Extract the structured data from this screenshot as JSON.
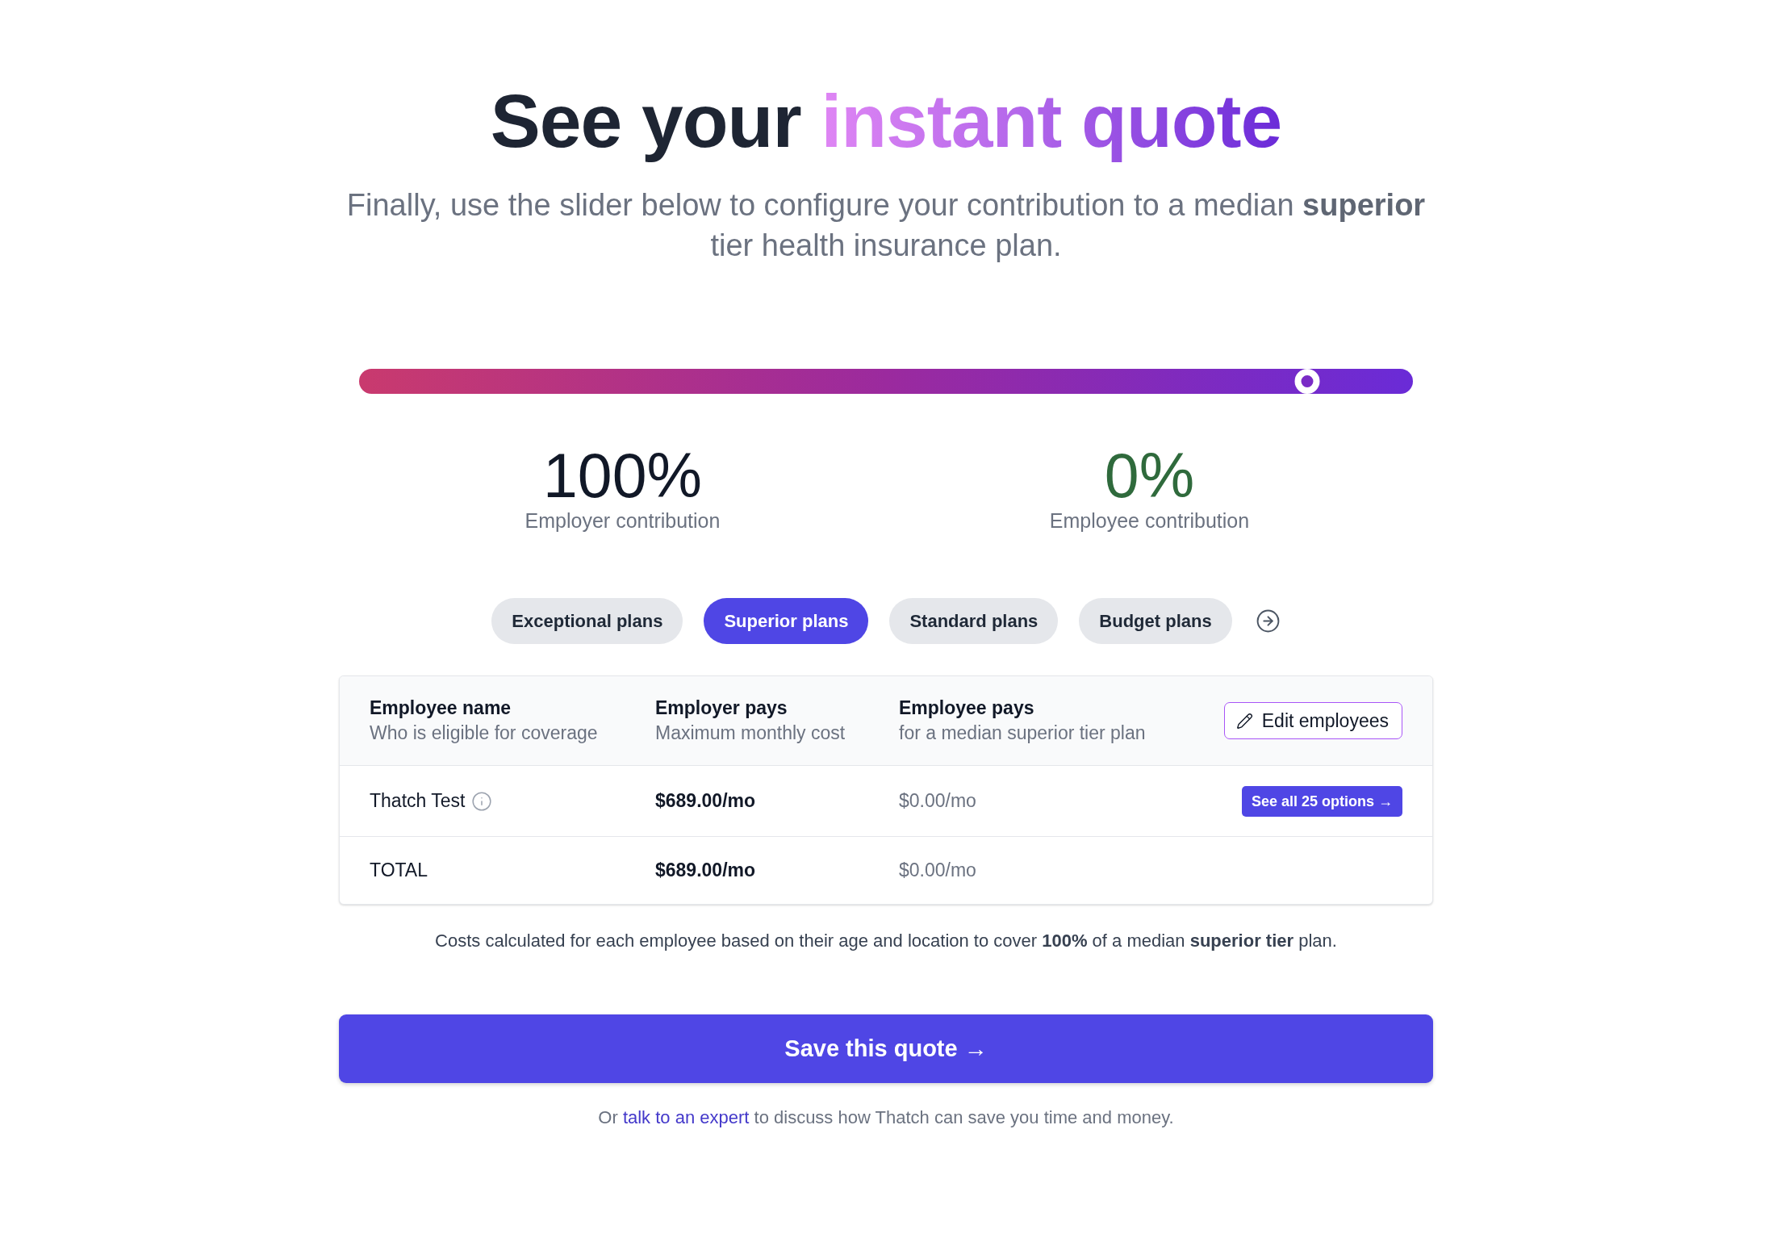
{
  "title": {
    "text": "See your",
    "highlight": "instant quote"
  },
  "subtitle": "Finally, use the slider below to configure your contribution to a median **superior** tier health insurance plan.",
  "slider": {
    "level": 0.9
  },
  "contributions": [
    {
      "value": "100%",
      "label": "Employer contribution",
      "color": "#111827"
    },
    {
      "value": "0%",
      "label": "Employee contribution",
      "color": "#2f6a3c"
    }
  ],
  "plan_tabs": [
    {
      "label": "Exceptional plans",
      "selected": false
    },
    {
      "label": "Superior plans",
      "selected": true
    },
    {
      "label": "Standard plans",
      "selected": false
    },
    {
      "label": "Budget plans",
      "selected": false
    }
  ],
  "table": {
    "columns": [
      {
        "title": "Employee name",
        "subtitle": "Who is eligible for coverage"
      },
      {
        "title": "Employer pays",
        "subtitle": "Maximum monthly cost"
      },
      {
        "title": "Employee pays",
        "subtitle": "for a median superior tier plan"
      }
    ],
    "edit_button": "Edit employees",
    "rows": [
      {
        "kind": "employee",
        "name": "Thatch Test",
        "employer_pays": "$689.00/mo",
        "employee_pays": "$0.00/mo",
        "action": "See all 25 options →"
      },
      {
        "kind": "total",
        "name": "TOTAL",
        "employer_pays": "$689.00/mo",
        "employee_pays": "$0.00/mo"
      }
    ]
  },
  "cost_note": "Costs calculated for each employee based on their age and location to cover **100%** of a median **superior tier** plan.",
  "save_button": "Save this quote →",
  "footer": {
    "before": "Or",
    "link": "talk to an expert",
    "after": "to discuss how Thatch can save you time and money."
  }
}
